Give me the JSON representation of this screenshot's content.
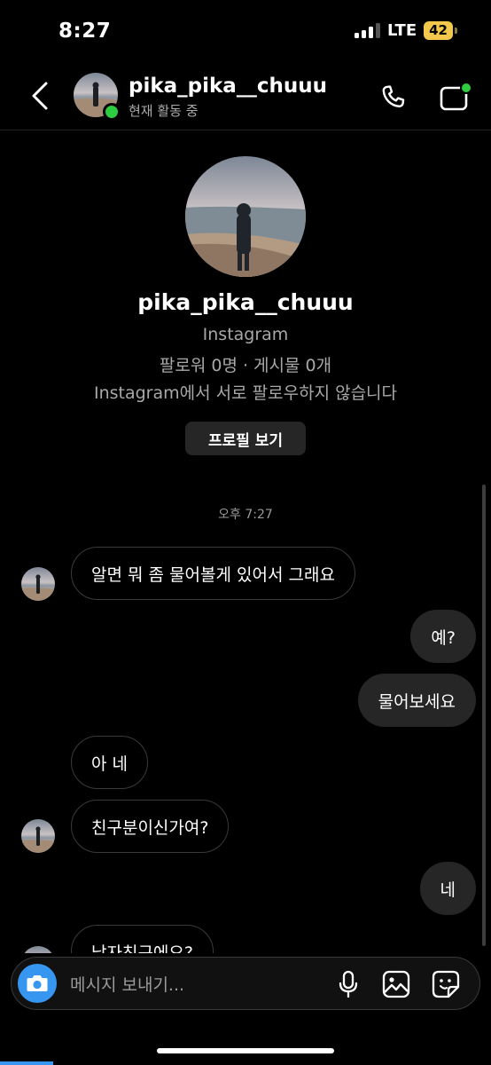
{
  "status_bar": {
    "time": "8:27",
    "carrier": "LTE",
    "battery": "42"
  },
  "header": {
    "username": "pika_pika__chuuu",
    "status": "현재 활동 중",
    "icons": {
      "back": "chevron-left-icon",
      "call": "phone-icon",
      "video": "video-camera-icon"
    }
  },
  "profile": {
    "username": "pika_pika__chuuu",
    "app": "Instagram",
    "stats": "팔로워 0명 · 게시물 0개",
    "relation": "Instagram에서 서로 팔로우하지 않습니다",
    "view_profile_button": "프로필 보기"
  },
  "timestamp": "오후 7:27",
  "messages": [
    {
      "from": "them",
      "text": "알면 뭐 좀 물어볼게 있어서 그래요"
    },
    {
      "from": "me",
      "text": "예?"
    },
    {
      "from": "me",
      "text": "물어보세요"
    },
    {
      "from": "them",
      "text": "아 네"
    },
    {
      "from": "them",
      "text": "친구분이신가여?"
    },
    {
      "from": "me",
      "text": "네"
    },
    {
      "from": "them",
      "text": "남자친구에요?"
    }
  ],
  "composer": {
    "placeholder": "메시지 보내기...",
    "icons": [
      "camera-icon",
      "microphone-icon",
      "gallery-icon",
      "sticker-icon"
    ]
  },
  "colors": {
    "background": "#000000",
    "accent_blue": "#3797f0",
    "online_green": "#2ecc40",
    "battery_yellow": "#f2c94c",
    "outgoing_bubble": "#262626"
  }
}
